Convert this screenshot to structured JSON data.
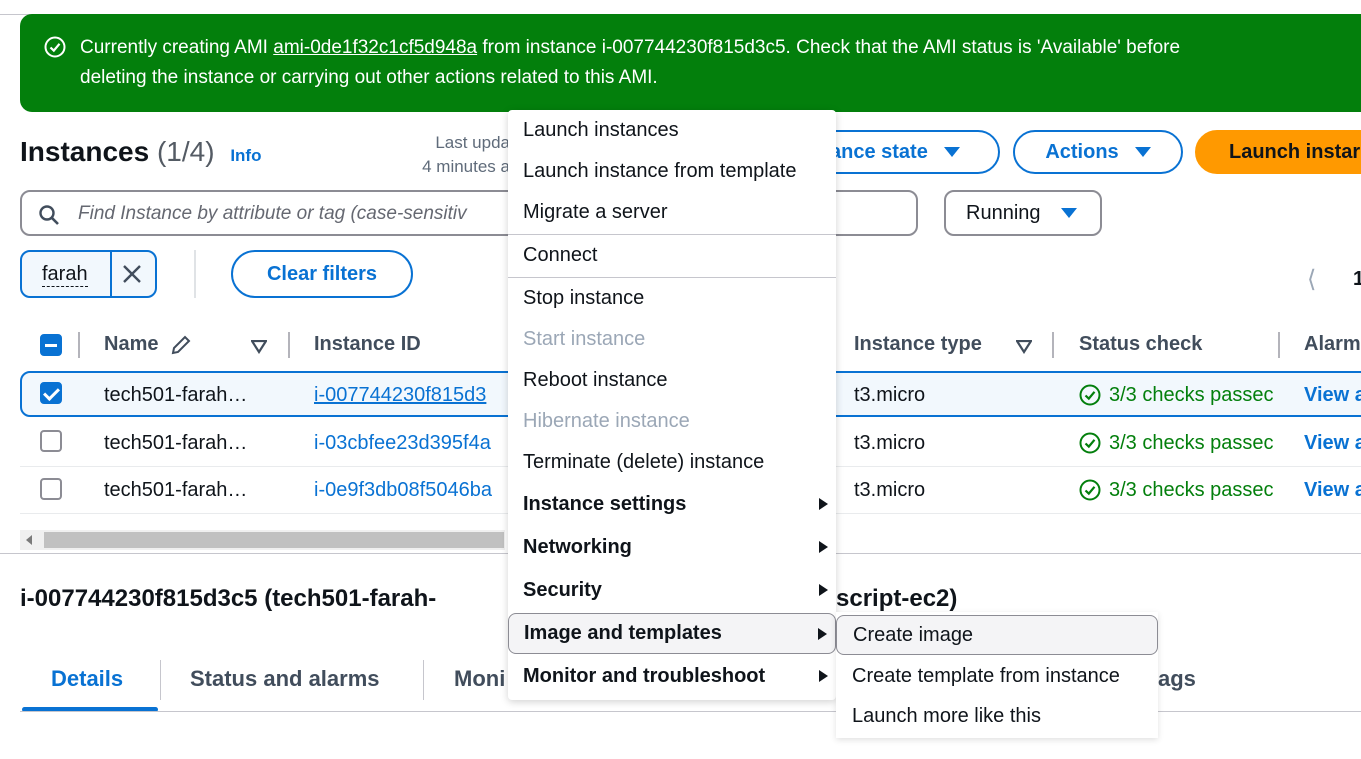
{
  "banner": {
    "prefix": "Currently creating AMI ",
    "ami_link": "ami-0de1f32c1cf5d948a",
    "line1_suffix": " from instance i-007744230f815d3c5. Check that the AMI status is 'Available' before",
    "line2": "deleting the instance or carrying out other actions related to this AMI.",
    "color": "#037f0c"
  },
  "header": {
    "title": "Instances",
    "count": "(1/4)",
    "info": "Info",
    "last_updated_line1": "Last upda",
    "last_updated_line2": "4 minutes a",
    "instance_state_button": "ance state",
    "actions_button": "Actions",
    "launch_button": "Launch instar"
  },
  "search": {
    "placeholder": "Find Instance by attribute or tag (case-sensitiv"
  },
  "state_filter": {
    "value": "Running"
  },
  "filters": {
    "token": "farah",
    "clear": "Clear filters"
  },
  "pagination": {
    "page": "1"
  },
  "table": {
    "columns": {
      "name": "Name",
      "instance_id": "Instance ID",
      "instance_type": "Instance type",
      "status_check": "Status check",
      "alarm": "Alarm"
    },
    "rows": [
      {
        "name": "tech501-farah…",
        "id": "i-007744230f815d3",
        "type": "t3.micro",
        "status": "3/3 checks passec",
        "alarm": "View a",
        "selected": true
      },
      {
        "name": "tech501-farah…",
        "id": "i-03cbfee23d395f4a",
        "type": "t3.micro",
        "status": "3/3 checks passec",
        "alarm": "View a",
        "selected": false
      },
      {
        "name": "tech501-farah…",
        "id": "i-0e9f3db08f5046ba",
        "type": "t3.micro",
        "status": "3/3 checks passec",
        "alarm": "View a",
        "selected": false
      }
    ]
  },
  "detail": {
    "title_left": "i-007744230f815d3c5 (tech501-farah-",
    "title_right": "script-ec2)",
    "tabs": {
      "details": "Details",
      "status": "Status and alarms",
      "monitoring": "Moni",
      "tags": "ags"
    }
  },
  "menu": {
    "launch": "Launch instances",
    "launch_template": "Launch instance from template",
    "migrate": "Migrate a server",
    "connect": "Connect",
    "stop": "Stop instance",
    "start": "Start instance",
    "reboot": "Reboot instance",
    "hibernate": "Hibernate instance",
    "terminate": "Terminate (delete) instance",
    "settings": "Instance settings",
    "networking": "Networking",
    "security": "Security",
    "image": "Image and templates",
    "monitor": "Monitor and troubleshoot"
  },
  "submenu": {
    "create_image": "Create image",
    "create_template": "Create template from instance",
    "launch_more": "Launch more like this"
  }
}
